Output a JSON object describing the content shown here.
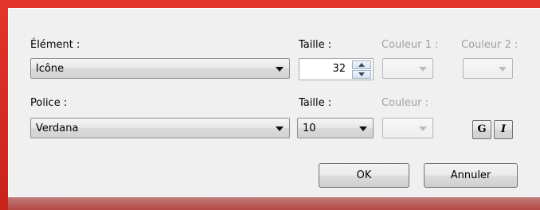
{
  "colors": {
    "window_frame": "#d42a22",
    "panel_bg": "#f0f0f0",
    "disabled_text": "#a0a0a0"
  },
  "element_label": "Élément :",
  "element_select_value": "Icône",
  "size_label_1": "Taille :",
  "size_spin_value": "32",
  "color1_label": "Couleur 1 :",
  "color2_label": "Couleur 2 :",
  "font_label": "Police :",
  "font_select_value": "Verdana",
  "size_label_2": "Taille :",
  "font_size_value": "10",
  "color_label": "Couleur :",
  "bold_label": "G",
  "italic_label": "I",
  "ok_label": "OK",
  "cancel_label": "Annuler"
}
